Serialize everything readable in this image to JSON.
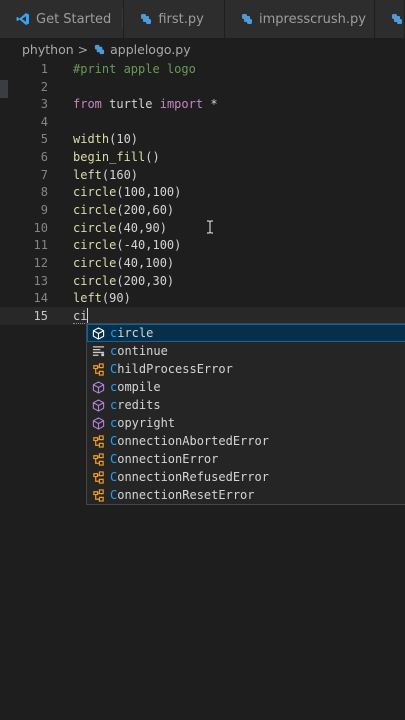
{
  "tabs": [
    {
      "label": "Get Started",
      "icon": "vscode-logo-icon"
    },
    {
      "label": "first.py",
      "icon": "python-file-icon"
    },
    {
      "label": "impresscrush.py",
      "icon": "python-file-icon"
    }
  ],
  "breadcrumb": {
    "folder": "phython",
    "separator": ">",
    "file": "applelogo.py"
  },
  "editor": {
    "lines": [
      {
        "n": "1",
        "text": "#print apple logo"
      },
      {
        "n": "2",
        "text": ""
      },
      {
        "n": "3",
        "kw": "from",
        "mid": "turtle",
        "kw2": "import",
        "tail": "*"
      },
      {
        "n": "4",
        "text": ""
      },
      {
        "n": "5",
        "fn": "width",
        "args": "(10)"
      },
      {
        "n": "6",
        "fn": "begin_fill",
        "args": "()"
      },
      {
        "n": "7",
        "fn": "left",
        "args": "(160)"
      },
      {
        "n": "8",
        "fn": "circle",
        "args": "(100,100)"
      },
      {
        "n": "9",
        "fn": "circle",
        "args": "(200,60)"
      },
      {
        "n": "10",
        "fn": "circle",
        "args": "(40,90)"
      },
      {
        "n": "11",
        "fn": "circle",
        "args": "(-40,100)"
      },
      {
        "n": "12",
        "fn": "circle",
        "args": "(40,100)"
      },
      {
        "n": "13",
        "fn": "circle",
        "args": "(200,30)"
      },
      {
        "n": "14",
        "fn": "left",
        "args": "(90)"
      },
      {
        "n": "15",
        "typed": "ci"
      }
    ]
  },
  "suggestions": {
    "items": [
      {
        "match": "c",
        "rest": "ircle",
        "icon": "cube-icon",
        "selected": true
      },
      {
        "match": "c",
        "rest": "ontinue",
        "icon": "keyword-icon"
      },
      {
        "match": "C",
        "rest": "hildProcessError",
        "icon": "class-icon"
      },
      {
        "match": "c",
        "rest": "ompile",
        "icon": "cube-icon"
      },
      {
        "match": "c",
        "rest": "redits",
        "icon": "cube-icon"
      },
      {
        "match": "c",
        "rest": "opyright",
        "icon": "cube-icon"
      },
      {
        "match": "C",
        "rest": "onnectionAbortedError",
        "icon": "class-icon"
      },
      {
        "match": "C",
        "rest": "onnectionError",
        "icon": "class-icon"
      },
      {
        "match": "C",
        "rest": "onnectionRefusedError",
        "icon": "class-icon"
      },
      {
        "match": "C",
        "rest": "onnectionResetError",
        "icon": "class-icon"
      }
    ]
  }
}
